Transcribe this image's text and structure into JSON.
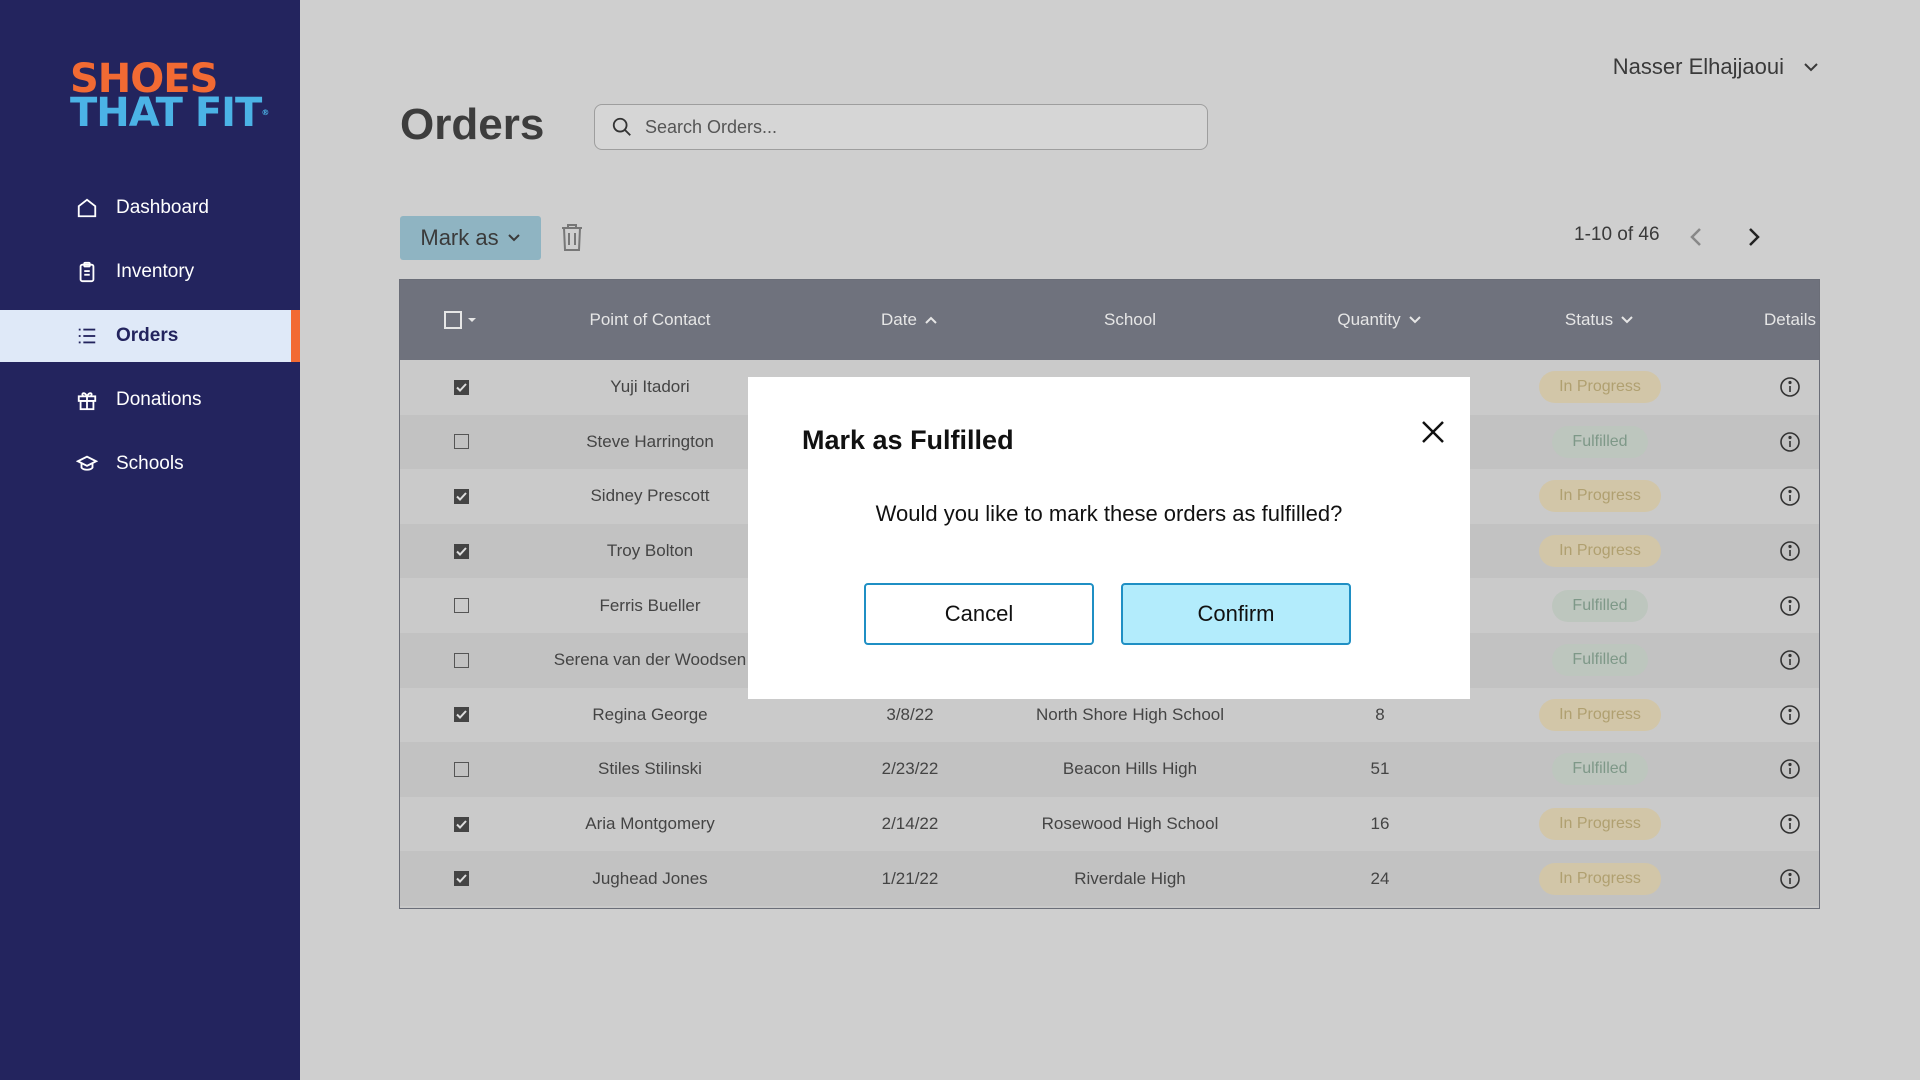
{
  "app": {
    "logo_line1": "SHOES",
    "logo_line2": "THAT FIT",
    "logo_mark": "®"
  },
  "sidebar": {
    "items": [
      {
        "label": "Dashboard",
        "icon": "home-icon",
        "active": false
      },
      {
        "label": "Inventory",
        "icon": "clipboard-icon",
        "active": false
      },
      {
        "label": "Orders",
        "icon": "list-icon",
        "active": true
      },
      {
        "label": "Donations",
        "icon": "gift-icon",
        "active": false
      },
      {
        "label": "Schools",
        "icon": "graduation-cap-icon",
        "active": false
      }
    ]
  },
  "header": {
    "user_name": "Nasser Elhajjaoui",
    "page_title": "Orders",
    "search_placeholder": "Search Orders..."
  },
  "toolbar": {
    "mark_as_label": "Mark as",
    "pagination": "1-10 of 46"
  },
  "table": {
    "columns": {
      "contact": "Point of Contact",
      "date": "Date",
      "school": "School",
      "quantity": "Quantity",
      "status": "Status",
      "details": "Details"
    },
    "rows": [
      {
        "checked": true,
        "contact": "Yuji Itadori",
        "date": "",
        "school": "",
        "quantity": "",
        "status": "In Progress"
      },
      {
        "checked": false,
        "contact": "Steve Harrington",
        "date": "",
        "school": "",
        "quantity": "",
        "status": "Fulfilled"
      },
      {
        "checked": true,
        "contact": "Sidney Prescott",
        "date": "",
        "school": "",
        "quantity": "",
        "status": "In Progress"
      },
      {
        "checked": true,
        "contact": "Troy Bolton",
        "date": "",
        "school": "",
        "quantity": "",
        "status": "In Progress"
      },
      {
        "checked": false,
        "contact": "Ferris Bueller",
        "date": "",
        "school": "",
        "quantity": "",
        "status": "Fulfilled"
      },
      {
        "checked": false,
        "contact": "Serena van der Woodsen",
        "date": "",
        "school": "",
        "quantity": "",
        "status": "Fulfilled"
      },
      {
        "checked": true,
        "contact": "Regina George",
        "date": "3/8/22",
        "school": "North Shore High School",
        "quantity": "8",
        "status": "In Progress"
      },
      {
        "checked": false,
        "contact": "Stiles Stilinski",
        "date": "2/23/22",
        "school": "Beacon Hills High",
        "quantity": "51",
        "status": "Fulfilled"
      },
      {
        "checked": true,
        "contact": "Aria Montgomery",
        "date": "2/14/22",
        "school": "Rosewood High School",
        "quantity": "16",
        "status": "In Progress"
      },
      {
        "checked": true,
        "contact": "Jughead Jones",
        "date": "1/21/22",
        "school": "Riverdale High",
        "quantity": "24",
        "status": "In Progress"
      }
    ]
  },
  "modal": {
    "title": "Mark as Fulfilled",
    "message": "Would you like to mark these orders as fulfilled?",
    "cancel_label": "Cancel",
    "confirm_label": "Confirm"
  },
  "colors": {
    "sidebar_bg": "#23245e",
    "brand_orange": "#f26a33",
    "brand_blue": "#4bb3e6",
    "confirm_bg": "#b3ecfc"
  }
}
